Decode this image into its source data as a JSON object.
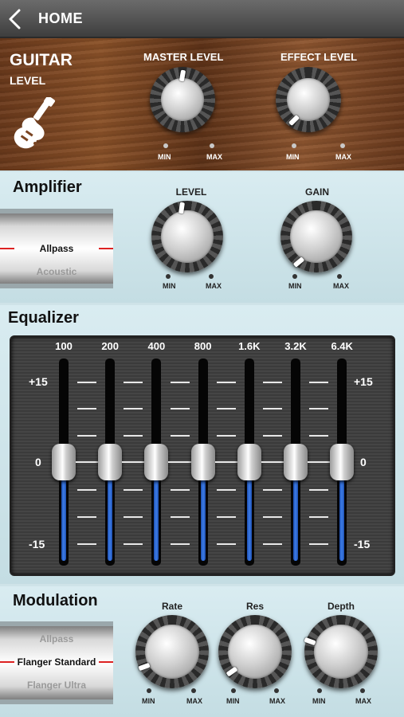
{
  "topbar": {
    "back_icon": "chevron-left-icon",
    "home_label": "HOME"
  },
  "guitar": {
    "title": "GUITAR",
    "subtitle": "LEVEL",
    "icon": "electric-guitar-icon",
    "knobs": [
      {
        "label": "MASTER LEVEL",
        "min": "MIN",
        "max": "MAX",
        "level": 0.5
      },
      {
        "label": "EFFECT LEVEL",
        "min": "MIN",
        "max": "MAX",
        "level": 0.15
      }
    ]
  },
  "amplifier": {
    "title": "Amplifier",
    "drum": {
      "items": [
        "Allpass",
        "Acoustic"
      ],
      "selected": "Allpass"
    },
    "knobs": [
      {
        "label": "LEVEL",
        "min": "MIN",
        "max": "MAX",
        "level": 0.5
      },
      {
        "label": "GAIN",
        "min": "MIN",
        "max": "MAX",
        "level": 0.1
      }
    ]
  },
  "equalizer": {
    "title": "Equalizer",
    "scale_top": "+15",
    "scale_mid": "0",
    "scale_bottom": "-15",
    "bands": [
      {
        "freq": "100",
        "gain": 0
      },
      {
        "freq": "200",
        "gain": 0
      },
      {
        "freq": "400",
        "gain": 0
      },
      {
        "freq": "800",
        "gain": 0
      },
      {
        "freq": "1.6K",
        "gain": 0
      },
      {
        "freq": "3.2K",
        "gain": 0
      },
      {
        "freq": "6.4K",
        "gain": 0
      }
    ]
  },
  "modulation": {
    "title": "Modulation",
    "drum": {
      "items": [
        "Allpass",
        "Flanger Standard",
        "Flanger Ultra"
      ],
      "selected": "Flanger Standard"
    },
    "knobs": [
      {
        "label": "Rate",
        "min": "MIN",
        "max": "MAX",
        "level": 0.1
      },
      {
        "label": "Res",
        "min": "MIN",
        "max": "MAX",
        "level": 0.05
      },
      {
        "label": "Depth",
        "min": "MIN",
        "max": "MAX",
        "level": 0.15
      }
    ]
  },
  "colors": {
    "accent_blue": "#3d7de8",
    "wood": "#7a4522",
    "panel": "#cfe3e8"
  }
}
